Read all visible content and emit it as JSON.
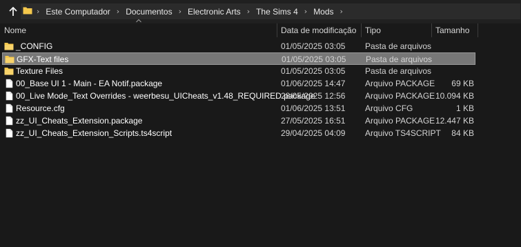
{
  "address": {
    "crumbs": [
      "Este Computador",
      "Documentos",
      "Electronic Arts",
      "The Sims 4",
      "Mods"
    ]
  },
  "columns": {
    "name": "Nome",
    "date": "Data de modificação",
    "type": "Tipo",
    "size": "Tamanho"
  },
  "files": [
    {
      "name": "_CONFIG",
      "date": "01/05/2025 03:05",
      "type": "Pasta de arquivos",
      "size": "",
      "icon": "folder-icon"
    },
    {
      "name": "GFX-Text files",
      "date": "01/05/2025 03:05",
      "type": "Pasta de arquivos",
      "size": "",
      "icon": "folder-icon",
      "selected": true
    },
    {
      "name": "Texture Files",
      "date": "01/05/2025 03:05",
      "type": "Pasta de arquivos",
      "size": "",
      "icon": "folder-icon"
    },
    {
      "name": "00_Base UI 1 - Main - EA Notif.package",
      "date": "01/06/2025 14:47",
      "type": "Arquivo PACKAGE",
      "size": "69 KB",
      "icon": "file-icon"
    },
    {
      "name": "00_Live Mode_Text Overrides - weerbesu_UICheats_v1.48_REQUIRED.package",
      "date": "28/05/2025 12:56",
      "type": "Arquivo PACKAGE",
      "size": "10.094 KB",
      "icon": "file-icon"
    },
    {
      "name": "Resource.cfg",
      "date": "01/06/2025 13:51",
      "type": "Arquivo CFG",
      "size": "1 KB",
      "icon": "file-icon"
    },
    {
      "name": "zz_UI_Cheats_Extension.package",
      "date": "27/05/2025 16:51",
      "type": "Arquivo PACKAGE",
      "size": "12.447 KB",
      "icon": "file-icon"
    },
    {
      "name": "zz_UI_Cheats_Extension_Scripts.ts4script",
      "date": "29/04/2025 04:09",
      "type": "Arquivo TS4SCRIPT",
      "size": "84 KB",
      "icon": "file-icon"
    }
  ],
  "colors": {
    "background": "#191919",
    "folder": "#f5c84c",
    "selection": "#777777"
  }
}
